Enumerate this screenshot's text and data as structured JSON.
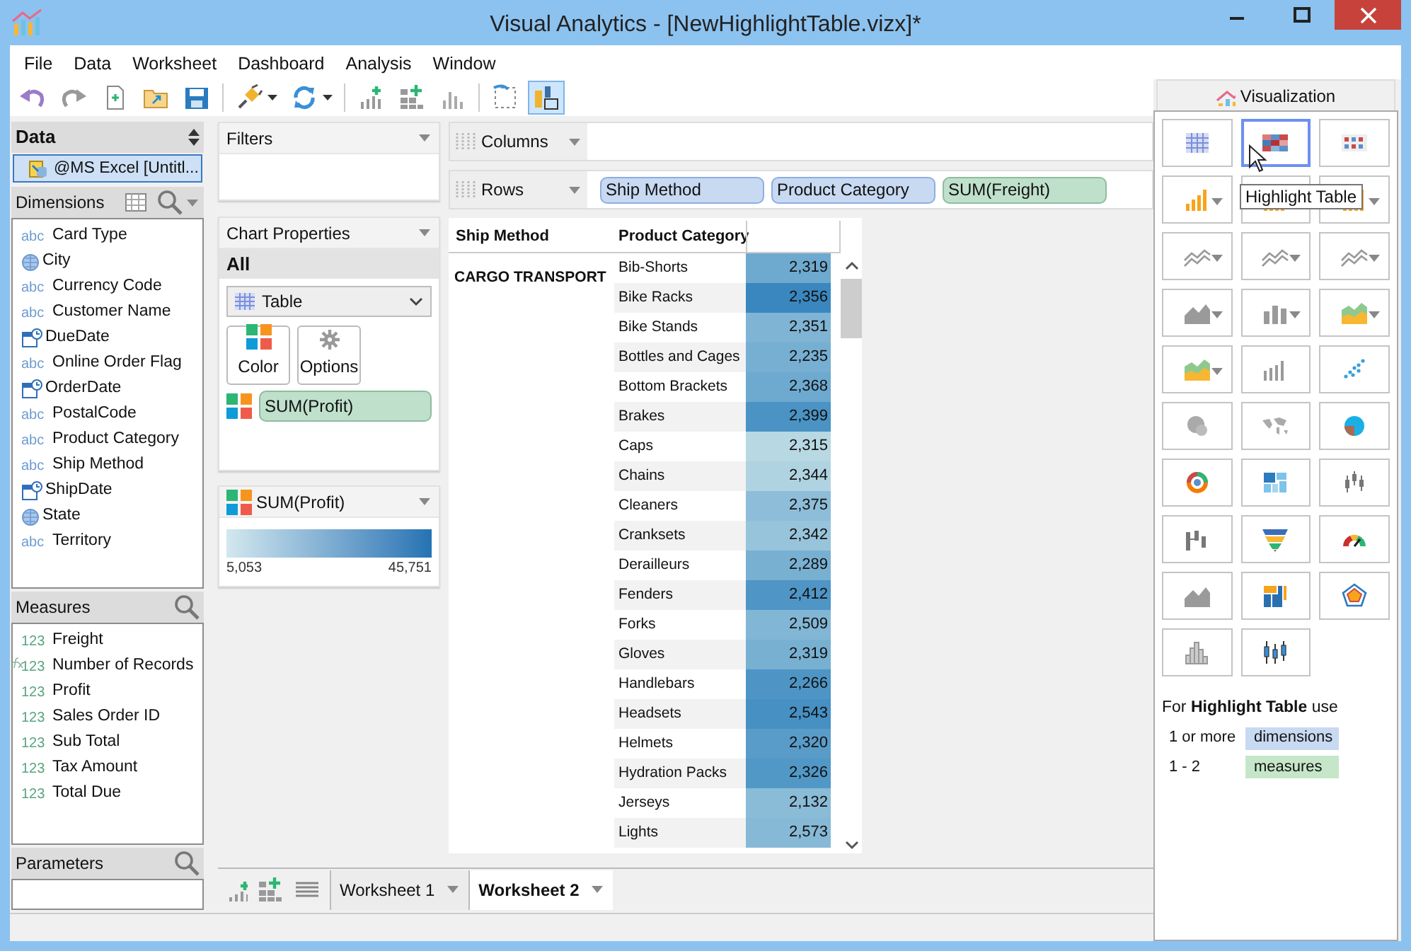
{
  "window": {
    "title": "Visual Analytics - [NewHighlightTable.vizx]*"
  },
  "menu": [
    "File",
    "Data",
    "Worksheet",
    "Dashboard",
    "Analysis",
    "Window"
  ],
  "toolbar": [
    {
      "kind": "undo",
      "selected": false
    },
    {
      "kind": "redo",
      "selected": false
    },
    {
      "kind": "new",
      "selected": false
    },
    {
      "kind": "open",
      "selected": false
    },
    {
      "kind": "save",
      "selected": false
    },
    {
      "kind": "separator"
    },
    {
      "kind": "connect",
      "selected": false,
      "has_menu": true
    },
    {
      "kind": "refresh",
      "selected": false,
      "has_menu": true
    },
    {
      "kind": "separator"
    },
    {
      "kind": "add-chart",
      "selected": false
    },
    {
      "kind": "add-grid",
      "selected": false
    },
    {
      "kind": "bars",
      "selected": false
    },
    {
      "kind": "separator"
    },
    {
      "kind": "lasso",
      "selected": false
    },
    {
      "kind": "layout",
      "selected": true
    }
  ],
  "data_panel": {
    "title": "Data",
    "source": {
      "label": "@MS Excel [Untitl...",
      "selected": true
    },
    "dimensions": {
      "title": "Dimensions",
      "items": [
        {
          "kind": "text",
          "badge": "abc",
          "name": "Card Type"
        },
        {
          "kind": "geo",
          "name": "City"
        },
        {
          "kind": "text",
          "badge": "abc",
          "name": "Currency Code"
        },
        {
          "kind": "text",
          "badge": "abc",
          "name": "Customer Name"
        },
        {
          "kind": "date",
          "name": "DueDate"
        },
        {
          "kind": "text",
          "badge": "abc",
          "name": "Online Order Flag"
        },
        {
          "kind": "date",
          "name": "OrderDate"
        },
        {
          "kind": "text",
          "badge": "abc",
          "name": "PostalCode"
        },
        {
          "kind": "text",
          "badge": "abc",
          "name": "Product Category"
        },
        {
          "kind": "text",
          "badge": "abc",
          "name": "Ship Method"
        },
        {
          "kind": "date",
          "name": "ShipDate"
        },
        {
          "kind": "geo",
          "name": "State"
        },
        {
          "kind": "text",
          "badge": "abc",
          "name": "Territory"
        }
      ]
    },
    "measures": {
      "title": "Measures",
      "items": [
        {
          "kind": "number",
          "badge": "123",
          "name": "Freight"
        },
        {
          "kind": "calculated",
          "badge": "123",
          "name": "Number of Records"
        },
        {
          "kind": "number",
          "badge": "123",
          "name": "Profit"
        },
        {
          "kind": "number",
          "badge": "123",
          "name": "Sales Order ID"
        },
        {
          "kind": "number",
          "badge": "123",
          "name": "Sub Total"
        },
        {
          "kind": "number",
          "badge": "123",
          "name": "Tax Amount"
        },
        {
          "kind": "number",
          "badge": "123",
          "name": "Total Due"
        }
      ]
    },
    "parameters": {
      "title": "Parameters"
    }
  },
  "filters": {
    "title": "Filters"
  },
  "chart_properties": {
    "title": "Chart Properties",
    "scope": "All",
    "chart_type": "Table",
    "buttons": [
      {
        "kind": "color",
        "label": "Color"
      },
      {
        "kind": "options",
        "label": "Options"
      }
    ],
    "color_field": "SUM(Profit)"
  },
  "legend": {
    "title": "SUM(Profit)",
    "min": "5,053",
    "max": "45,751"
  },
  "shelves": [
    {
      "label": "Columns"
    },
    {
      "label": "Rows",
      "pills": [
        {
          "label": "Ship Method",
          "kind": "dimension"
        },
        {
          "label": "Product Category",
          "kind": "dimension"
        },
        {
          "label": "SUM(Freight)",
          "kind": "measure"
        }
      ]
    }
  ],
  "table": {
    "columns": [
      "Ship Method",
      "Product Category"
    ],
    "group": "CARGO TRANSPORT",
    "rows": [
      {
        "category": "Bib-Shorts",
        "value": "2,319",
        "color": "#6ea9cf"
      },
      {
        "category": "Bike Racks",
        "value": "2,356",
        "color": "#3a87bf"
      },
      {
        "category": "Bike Stands",
        "value": "2,351",
        "color": "#7fb4d4"
      },
      {
        "category": "Bottles and Cages",
        "value": "2,235",
        "color": "#76afd1"
      },
      {
        "category": "Bottom Brackets",
        "value": "2,368",
        "color": "#6ea9cf"
      },
      {
        "category": "Brakes",
        "value": "2,399",
        "color": "#4a93c4"
      },
      {
        "category": "Caps",
        "value": "2,315",
        "color": "#b8d8e3"
      },
      {
        "category": "Chains",
        "value": "2,344",
        "color": "#b0d3e1"
      },
      {
        "category": "Cleaners",
        "value": "2,375",
        "color": "#8dbdd8"
      },
      {
        "category": "Cranksets",
        "value": "2,342",
        "color": "#98c4db"
      },
      {
        "category": "Derailleurs",
        "value": "2,289",
        "color": "#78b0d2"
      },
      {
        "category": "Fenders",
        "value": "2,412",
        "color": "#4f95c6"
      },
      {
        "category": "Forks",
        "value": "2,509",
        "color": "#82b6d5"
      },
      {
        "category": "Gloves",
        "value": "2,319",
        "color": "#78b0d2"
      },
      {
        "category": "Handlebars",
        "value": "2,266",
        "color": "#4e95c6"
      },
      {
        "category": "Headsets",
        "value": "2,543",
        "color": "#4690c3"
      },
      {
        "category": "Helmets",
        "value": "2,320",
        "color": "#5a9cc9"
      },
      {
        "category": "Hydration Packs",
        "value": "2,326",
        "color": "#5198c7"
      },
      {
        "category": "Jerseys",
        "value": "2,132",
        "color": "#8abbd7"
      },
      {
        "category": "Lights",
        "value": "2,573",
        "color": "#86b9d6"
      }
    ]
  },
  "sheets": [
    {
      "label": "Worksheet 1",
      "selected": false
    },
    {
      "label": "Worksheet 2",
      "selected": true
    }
  ],
  "visualization": {
    "title": "Visualization",
    "types": [
      {
        "kind": "table",
        "selected": false
      },
      {
        "kind": "highlight",
        "selected": true
      },
      {
        "kind": "heatmap",
        "selected": false
      },
      {
        "kind": "bar",
        "selected": false,
        "has_menu": true
      },
      {
        "kind": "bar",
        "selected": false
      },
      {
        "kind": "bar",
        "selected": false,
        "has_menu": true
      },
      {
        "kind": "line",
        "selected": false,
        "has_menu": true
      },
      {
        "kind": "line",
        "selected": false,
        "has_menu": true
      },
      {
        "kind": "line",
        "selected": false,
        "has_menu": true
      },
      {
        "kind": "area",
        "selected": false,
        "has_menu": true
      },
      {
        "kind": "column",
        "selected": false,
        "has_menu": true
      },
      {
        "kind": "area-color",
        "selected": false,
        "has_menu": true
      },
      {
        "kind": "area-color",
        "selected": false,
        "has_menu": true
      },
      {
        "kind": "bars-gray",
        "selected": false
      },
      {
        "kind": "scatter",
        "selected": false
      },
      {
        "kind": "bubble",
        "selected": false
      },
      {
        "kind": "map",
        "selected": false
      },
      {
        "kind": "pie",
        "selected": false
      },
      {
        "kind": "donut",
        "selected": false
      },
      {
        "kind": "treemap",
        "selected": false
      },
      {
        "kind": "candlestick",
        "selected": false
      },
      {
        "kind": "waterfall",
        "selected": false
      },
      {
        "kind": "funnel",
        "selected": false
      },
      {
        "kind": "gauge",
        "selected": false
      },
      {
        "kind": "area",
        "selected": false
      },
      {
        "kind": "treemap-color",
        "selected": false
      },
      {
        "kind": "radar",
        "selected": false
      },
      {
        "kind": "histogram",
        "selected": false
      },
      {
        "kind": "boxplot",
        "selected": false
      }
    ],
    "tooltip": "Highlight Table",
    "hint": "For **Highlight Table** use",
    "requirements": [
      {
        "count": "1 or more",
        "label": "dimensions",
        "kind": "dimension"
      },
      {
        "count": "1 - 2",
        "label": "measures",
        "kind": "measure"
      }
    ]
  }
}
